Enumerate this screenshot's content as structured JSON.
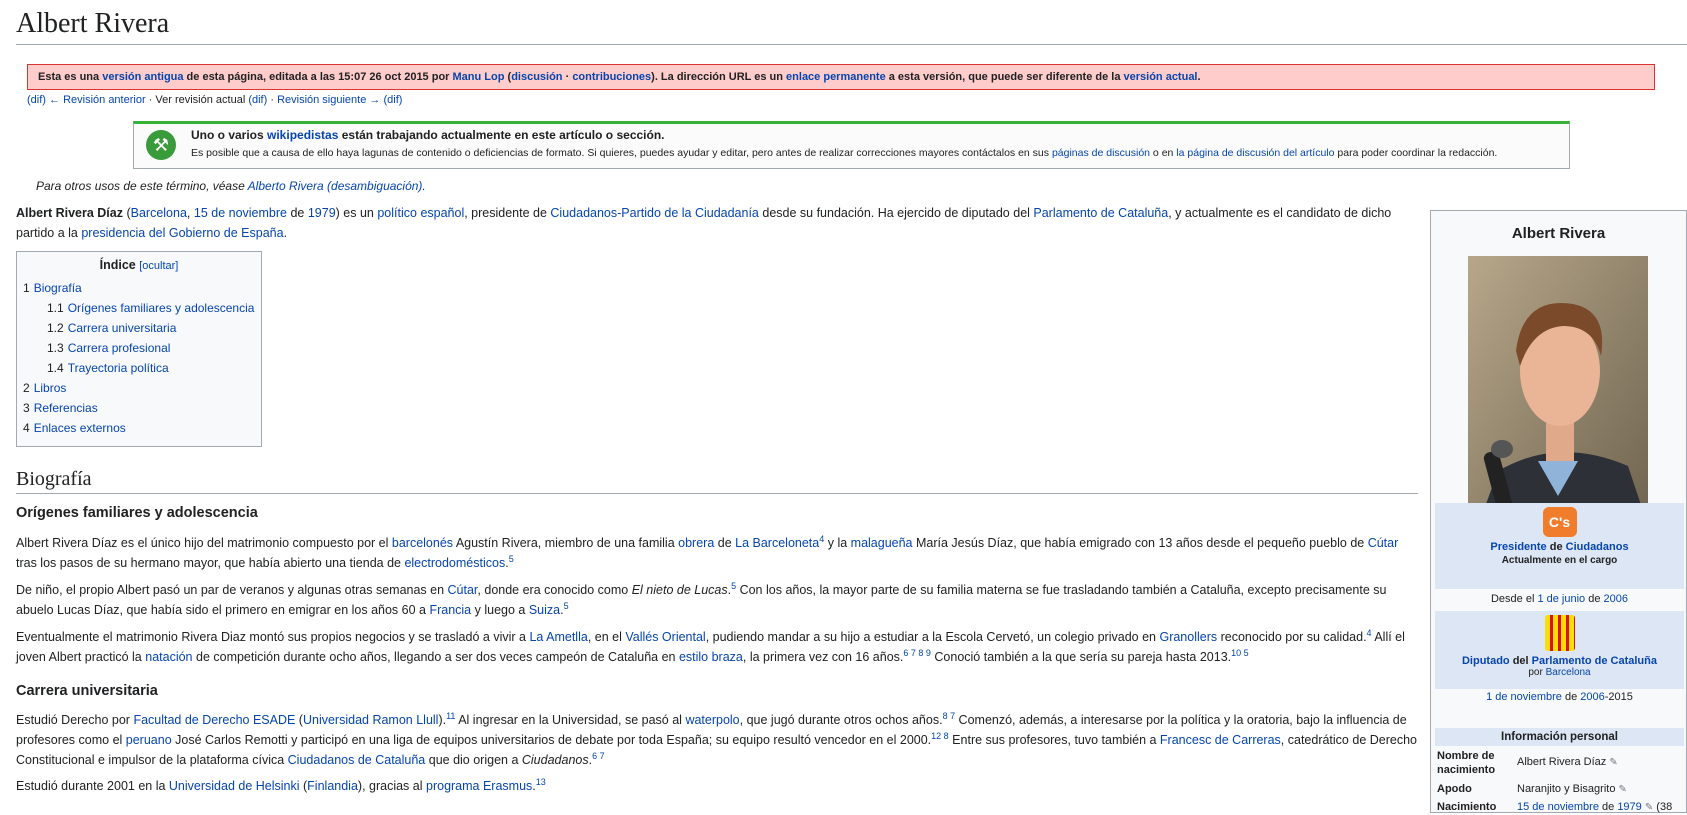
{
  "title": "Albert Rivera",
  "revision": {
    "t1": "Esta es una ",
    "link1": "versión antigua",
    "t2": " de esta página, editada a las 15:07 26 oct 2015 por ",
    "user": "Manu Lop",
    "t3": " (",
    "talk": "discusión",
    "sep": " · ",
    "contribs": "contribuciones",
    "t4": "). La dirección URL es un ",
    "permalink": "enlace permanente",
    "t5": " a esta versión, que puede ser diferente de la ",
    "current": "versión actual",
    "t6": "."
  },
  "revnav": {
    "dif1": "(dif)",
    "prev": "← Revisión anterior",
    "sep1": " · ",
    "actual_text": "Ver revisión actual ",
    "dif2": "(dif)",
    "sep2": " · ",
    "next": "Revisión siguiente →",
    "dif3": "(dif)"
  },
  "inuse": {
    "l1a": "Uno o varios ",
    "l1link": "wikipedistas",
    "l1b": " están trabajando actualmente en este artículo o sección.",
    "l2a": "Es posible que a causa de ello haya lagunas de contenido o deficiencias de formato. Si quieres, puedes ayudar y editar, pero antes de realizar correcciones mayores contáctalos en sus ",
    "l2link1": "páginas de discusión",
    "l2b": " o en ",
    "l2link2": "la página de discusión del artículo",
    "l2c": " para poder coordinar la redacción."
  },
  "hatnote": {
    "text": "Para otros usos de este término, véase ",
    "link": "Alberto Rivera (desambiguación)",
    "end": "."
  },
  "lead": {
    "name": "Albert Rivera Díaz",
    "p1": " (",
    "birthplace": "Barcelona",
    "c1": ", ",
    "date": "15 de noviembre",
    "de": " de ",
    "year": "1979",
    "p2": ") es un ",
    "politico": "político español",
    "p3": ", presidente de ",
    "party": "Ciudadanos-Partido de la Ciudadanía",
    "p4": " desde su fundación. Ha ejercido de diputado del ",
    "parl": "Parlamento de Cataluña",
    "p5": ", y actualmente es el candidato de dicho partido a la ",
    "pres": "presidencia del Gobierno de España",
    "p6": "."
  },
  "toc": {
    "title": "Índice",
    "hide": "[ocultar]",
    "items": [
      {
        "num": "1",
        "label": "Biografía",
        "sub": false
      },
      {
        "num": "1.1",
        "label": "Orígenes familiares y adolescencia",
        "sub": true
      },
      {
        "num": "1.2",
        "label": "Carrera universitaria",
        "sub": true
      },
      {
        "num": "1.3",
        "label": "Carrera profesional",
        "sub": true
      },
      {
        "num": "1.4",
        "label": "Trayectoria política",
        "sub": true
      },
      {
        "num": "2",
        "label": "Libros",
        "sub": false
      },
      {
        "num": "3",
        "label": "Referencias",
        "sub": false
      },
      {
        "num": "4",
        "label": "Enlaces externos",
        "sub": false
      }
    ]
  },
  "bio": {
    "h2": "Biografía",
    "h3a": "Orígenes familiares y adolescencia",
    "p1": {
      "a": "Albert Rivera Díaz es el único hijo del matrimonio compuesto por el ",
      "l1": "barcelonés",
      "b": " Agustín Rivera, miembro de una familia ",
      "l2": "obrera",
      "c": " de ",
      "l3": "La Barceloneta",
      "r1": "4",
      "d": " y la ",
      "l4": "malagueña",
      "e": " María Jesús Díaz, que había emigrado con 13 años desde el pequeño pueblo de ",
      "l5": "Cútar",
      "f": " tras los pasos de su hermano mayor, que había abierto una tienda de ",
      "l6": "electrodomésticos",
      "g": ".",
      "r2": "5"
    },
    "p2": {
      "a": "De niño, el propio Albert pasó un par de veranos y algunas otras semanas en ",
      "l1": "Cútar",
      "b": ", donde era conocido como ",
      "i": "El nieto de Lucas",
      "c": ".",
      "r1": "5",
      "d": " Con los años, la mayor parte de su familia materna se fue trasladando también a Cataluña, excepto precisamente su abuelo Lucas Díaz, que había sido el primero en emigrar en los años 60 a ",
      "l2": "Francia",
      "e": " y luego a ",
      "l3": "Suiza",
      "f": ".",
      "r2": "5"
    },
    "p3": {
      "a": "Eventualmente el matrimonio Rivera Diaz montó sus propios negocios y se trasladó a vivir a ",
      "l1": "La Ametlla",
      "b": ", en el ",
      "l2": "Vallés Oriental",
      "c": ", pudiendo mandar a su hijo a estudiar a la Escola Cervetó, un colegio privado en ",
      "l3": "Granollers",
      "d": " reconocido por su calidad.",
      "r1": "4",
      "e": " Allí el joven Albert practicó la ",
      "l4": "natación",
      "f": " de competición durante ocho años, llegando a ser dos veces campeón de Cataluña en ",
      "l5": "estilo braza",
      "g": ", la primera vez con 16 años.",
      "r2": "6 7 8 9",
      "h": " Conoció también a la que sería su pareja hasta 2013.",
      "r3": "10 5"
    },
    "h3b": "Carrera universitaria",
    "p4": {
      "a": "Estudió Derecho por ",
      "l1": "Facultad de Derecho ESADE",
      "b": " (",
      "l2": "Universidad Ramon Llull",
      "c": ").",
      "r1": "11",
      "d": " Al ingresar en la Universidad, se pasó al ",
      "l3": "waterpolo",
      "e": ", que jugó durante otros ochos años.",
      "r2": "8 7",
      "f": " Comenzó, además, a interesarse por la política y la oratoria, bajo la influencia de profesores como el ",
      "l4": "peruano",
      "g": " José Carlos Remotti y participó en una liga de equipos universitarios de debate por toda España; su equipo resultó vencedor en el 2000.",
      "r3": "12 8",
      "h": " Entre sus profesores, tuvo también a ",
      "l5": "Francesc de Carreras",
      "i": ", catedrático de Derecho Constitucional e impulsor de la plataforma cívica ",
      "l6": "Ciudadanos de Cataluña",
      "j": " que dio origen a ",
      "it": "Ciudadanos",
      "k": ".",
      "r4": "6 7"
    },
    "p5": {
      "a": "Estudió durante 2001 en la ",
      "l1": "Universidad de Helsinki",
      "b": " (",
      "l2": "Finlandia",
      "c": "), gracias al ",
      "l3": "programa Erasmus",
      "d": ".",
      "r1": "13"
    }
  },
  "infobox": {
    "title": "Albert Rivera",
    "office1": {
      "seal": "C's",
      "pos": "Presidente",
      "de": " de ",
      "org": "Ciudadanos",
      "current": "Actualmente en el cargo",
      "since_text": "Desde el ",
      "since_date": "1 de junio",
      "since_de": " de ",
      "since_year": "2006"
    },
    "office2": {
      "pos": "Diputado",
      "del": " del ",
      "org": "Parlamento de Cataluña",
      "por": "por ",
      "constituency": "Barcelona",
      "d1": "1 de noviembre",
      "de": " de ",
      "y1": "2006",
      "end": "-2015"
    },
    "section": "Información personal",
    "rows": [
      {
        "label": "Nombre de nacimiento",
        "value": "Albert Rivera Díaz"
      },
      {
        "label": "Apodo",
        "value": "Naranjito y Bisagrito"
      },
      {
        "label": "Nacimiento",
        "value_link": "15 de noviembre",
        "value_de": " de ",
        "value_year": "1979",
        "value_tail": " (38"
      }
    ]
  }
}
